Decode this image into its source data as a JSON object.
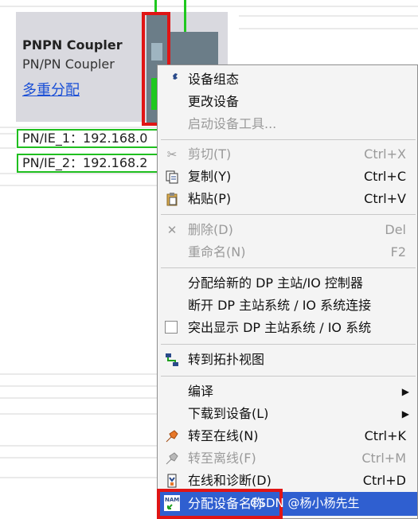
{
  "device": {
    "title": "PNPN Coupler",
    "subtitle": "PN/PN Coupler",
    "link": "多重分配"
  },
  "ie_labels": [
    "PN/IE_1：192.168.0",
    "PN/IE_2：192.168.2"
  ],
  "menu": {
    "items": [
      {
        "label": "设备组态",
        "icon": "wrench-icon",
        "enabled": true
      },
      {
        "label": "更改设备",
        "enabled": true
      },
      {
        "label": "启动设备工具...",
        "enabled": false
      },
      {
        "label": "剪切(T)",
        "shortcut": "Ctrl+X",
        "icon": "scissors-icon",
        "enabled": false
      },
      {
        "label": "复制(Y)",
        "shortcut": "Ctrl+C",
        "icon": "copy-icon",
        "enabled": true
      },
      {
        "label": "粘贴(P)",
        "shortcut": "Ctrl+V",
        "icon": "paste-icon",
        "enabled": true
      },
      {
        "label": "删除(D)",
        "shortcut": "Del",
        "icon": "delete-icon",
        "enabled": false
      },
      {
        "label": "重命名(N)",
        "shortcut": "F2",
        "enabled": false
      },
      {
        "label": "分配给新的 DP 主站/IO 控制器",
        "enabled": true
      },
      {
        "label": "断开 DP 主站系统 / IO 系统连接",
        "enabled": true
      },
      {
        "label": "突出显示 DP 主站系统 / IO 系统",
        "enabled": true
      },
      {
        "label": "转到拓扑视图",
        "icon": "topology-icon",
        "enabled": true
      },
      {
        "label": "编译",
        "enabled": true
      },
      {
        "label": "下载到设备(L)",
        "enabled": true
      },
      {
        "label": "转至在线(N)",
        "shortcut": "Ctrl+K",
        "icon": "go-online-icon",
        "enabled": true
      },
      {
        "label": "转至离线(F)",
        "shortcut": "Ctrl+M",
        "icon": "go-offline-icon",
        "enabled": false
      },
      {
        "label": "在线和诊断(D)",
        "shortcut": "Ctrl+D",
        "icon": "diagnostics-icon",
        "enabled": true
      },
      {
        "label": "分配设备名称",
        "icon": "name-assign-icon",
        "enabled": true,
        "highlighted": true
      }
    ]
  },
  "watermark": "CSDN @杨小杨先生",
  "colors": {
    "highlight": "#2f5fd0",
    "red_box": "#e01515",
    "green": "#1fc81f",
    "link": "#1a4fd6"
  }
}
